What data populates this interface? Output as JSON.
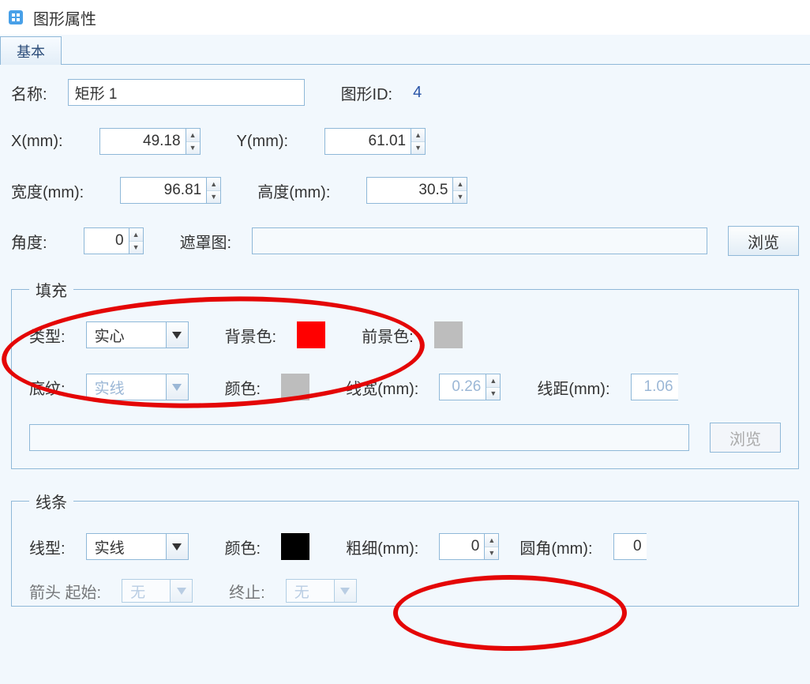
{
  "window": {
    "title": "图形属性"
  },
  "tabs": {
    "basic": "基本"
  },
  "labels": {
    "name": "名称:",
    "shape_id": "图形ID:",
    "x": "X(mm):",
    "y": "Y(mm):",
    "width": "宽度(mm):",
    "height": "高度(mm):",
    "angle": "角度:",
    "mask": "遮罩图:",
    "browse": "浏览",
    "fill_group": "填充",
    "type": "类型:",
    "bgcolor": "背景色:",
    "fgcolor": "前景色:",
    "pattern": "底纹:",
    "color": "颜色:",
    "line_width": "线宽(mm):",
    "line_spacing": "线距(mm):",
    "line_group": "线条",
    "line_type": "线型:",
    "thickness": "粗细(mm):",
    "radius": "圆角(mm):",
    "arrow_start": "箭头 起始:",
    "arrow_end": "终止:",
    "none": "无"
  },
  "values": {
    "name": "矩形 1",
    "shape_id": "4",
    "x": "49.18",
    "y": "61.01",
    "width": "96.81",
    "height": "30.5",
    "angle": "0",
    "mask": "",
    "fill_type": "实心",
    "pattern_type": "实线",
    "line_width": "0.26",
    "line_spacing": "1.06",
    "line_type": "实线",
    "line_color": "#000000",
    "thickness": "0",
    "radius": "0",
    "bg_color": "#ff0000",
    "fg_color": "#bdbdbd",
    "pattern_color": "#bdbdbd"
  }
}
